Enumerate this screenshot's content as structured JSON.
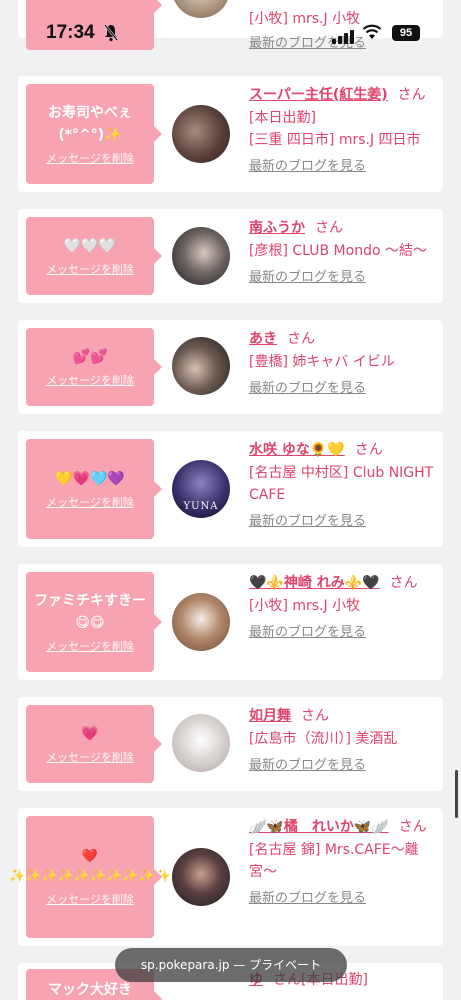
{
  "status_bar": {
    "time": "17:34",
    "battery": "95"
  },
  "url_bar": {
    "text": "sp.pokepara.jp — プライベート"
  },
  "labels": {
    "delete": "メッセージを削除",
    "blog": "最新のブログを見る",
    "san": "さん"
  },
  "cards": [
    {
      "message": "",
      "name": "",
      "store": "[小牧] mrs.J 小牧"
    },
    {
      "message": "お寿司やべぇ(*°^°)✨",
      "name": "スーパー主任(紅生姜)",
      "store_line1": "[本日出勤]",
      "store": "[三重 四日市] mrs.J 四日市"
    },
    {
      "message": "🤍🤍🤍",
      "name": "南ふうか",
      "store": "[彦根] CLUB Mondo 〜結〜"
    },
    {
      "message": "💕💕",
      "name": "あき",
      "store": "[豊橋] 姉キャバ イビル"
    },
    {
      "message": "💛💗🩵💜",
      "name": "水咲 ゆな🌻💛",
      "store": "[名古屋 中村区] Club NIGHT CAFE",
      "avatar_text": "YUNA"
    },
    {
      "message": "ファミチキすきー😋😋",
      "name": "🖤⚜️神崎 れみ⚜️🖤",
      "store": "[小牧] mrs.J 小牧"
    },
    {
      "message": "💗",
      "name": "如月舞",
      "store": "[広島市（流川）] 美酒乱"
    },
    {
      "message": "❤️ ✨✨✨✨✨✨✨✨✨✨",
      "name": "🪽🦋橘　れいか🦋🪽",
      "store": "[名古屋 錦] Mrs.CAFE〜離宮〜"
    },
    {
      "message": "マック大好き",
      "name": "ゆ",
      "store_line1": "[本日出勤]",
      "store": ""
    }
  ]
}
